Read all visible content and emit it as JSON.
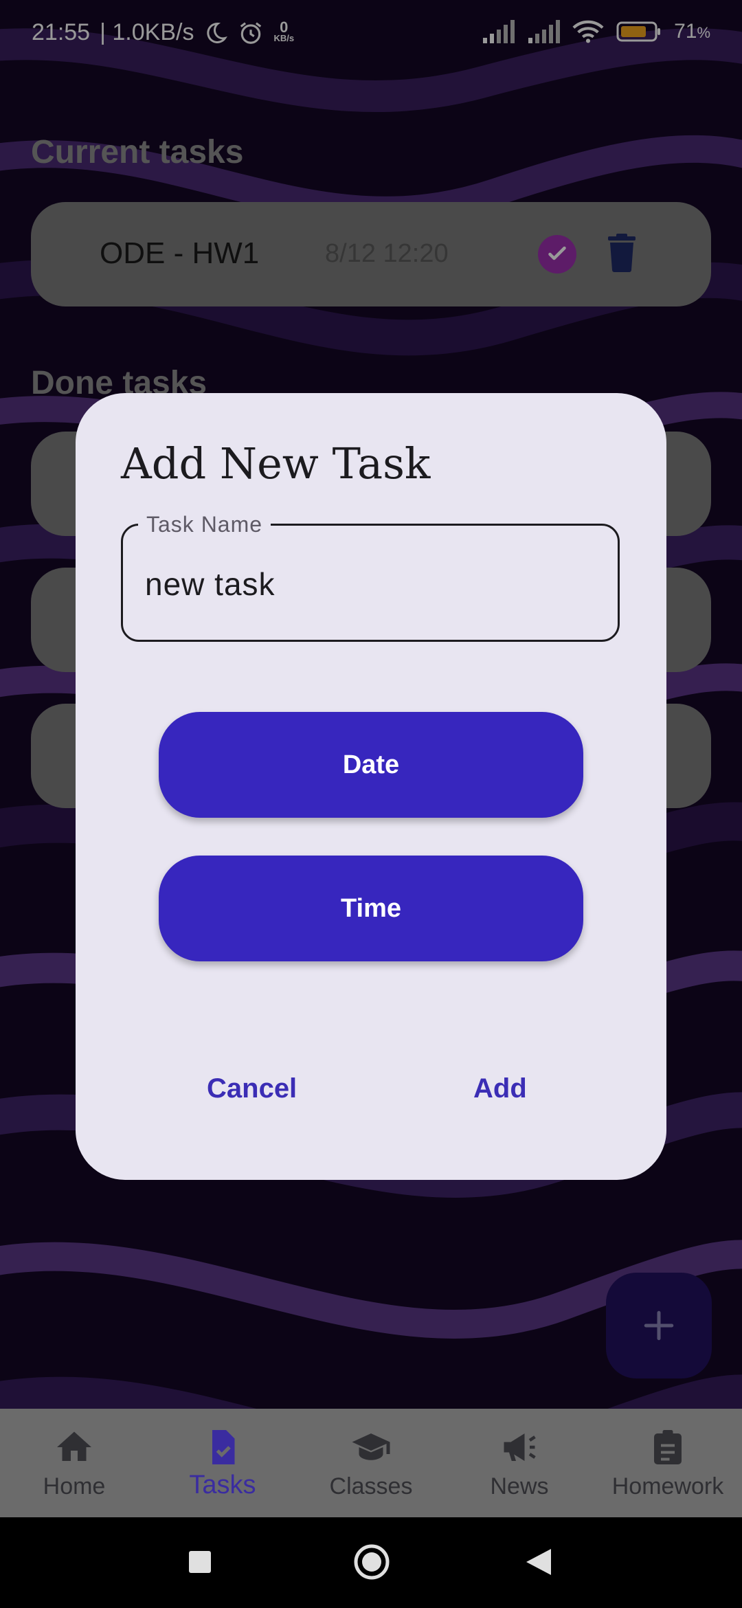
{
  "status_bar": {
    "time": "21:55",
    "speed": "| 1.0KB/s",
    "kbs_value": "0",
    "kbs_unit": "KB/s",
    "battery": "71",
    "battery_unit": "%"
  },
  "sections": {
    "current": "Current tasks",
    "done": "Done tasks"
  },
  "current_task": {
    "name": "ODE - HW1",
    "date": "8/12 12:20"
  },
  "dialog": {
    "title": "Add New Task",
    "field_label": "Task Name",
    "field_value": "new task",
    "date_button": "Date",
    "time_button": "Time",
    "cancel": "Cancel",
    "add": "Add"
  },
  "fab": {
    "icon": "plus-icon"
  },
  "bottom_nav": {
    "home": "Home",
    "tasks": "Tasks",
    "classes": "Classes",
    "news": "News",
    "homework": "Homework"
  },
  "colors": {
    "accent": "#3726be",
    "check": "#9b2fae",
    "trash": "#1f2a66",
    "dialog_bg": "#e8e5f1"
  }
}
